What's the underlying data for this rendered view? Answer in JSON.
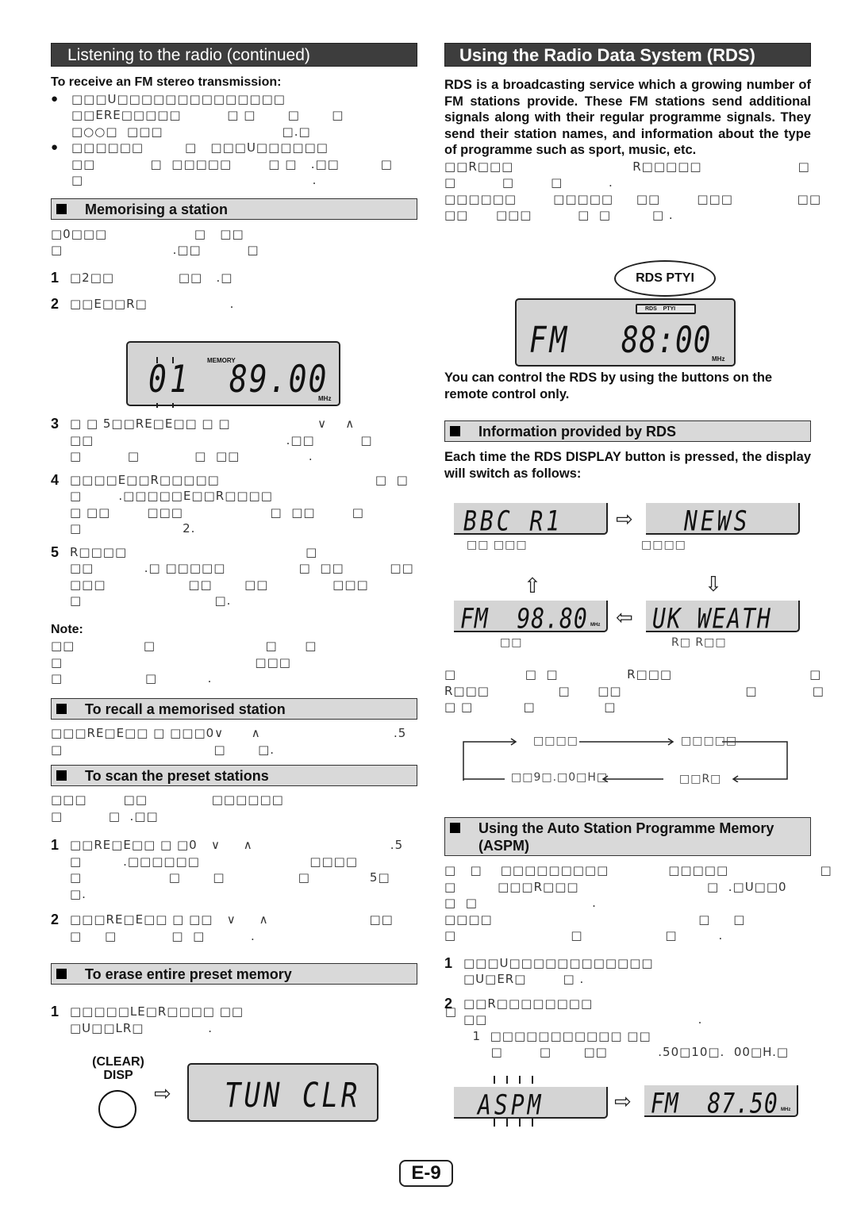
{
  "page_number": "E-9",
  "left": {
    "header": "Listening to the radio (continued)",
    "fm_stereo": {
      "title": "To receive an FM stereo transmission:",
      "bullets": [
        [
          "□□□U□□□□□□□□□□□□□□",
          "□□ERE□□□□□          □ □       □       □",
          "□○○□  □□□                          □.□"
        ],
        [
          "□□□□□□         □   □□□U□□□□□□",
          "□□            □  □□□□□        □ □   .□□         □",
          "□                                                  ."
        ]
      ]
    },
    "memorising": {
      "title": "Memorising a station",
      "intro": [
        "□0□□□                   □   □□",
        "□                        .□□          □"
      ],
      "steps": [
        {
          "num": "1",
          "lines": [
            "□2□□              □□   .□"
          ]
        },
        {
          "num": "2",
          "lines": [
            "□□E□□R□                  ."
          ]
        }
      ],
      "display": {
        "preset": "01",
        "indicator": "MEMORY",
        "frequency": "89.00",
        "unit": "MHz"
      },
      "steps_after": [
        {
          "num": "3",
          "lines": [
            "□ □ 5□□RE□E□□ □ □                   ∨    ∧",
            "□□                                          .□□          □",
            "□          □            □  □□               ."
          ]
        },
        {
          "num": "4",
          "lines": [
            "□□□□E□□R□□□□□                                  □  □",
            "□        .□□□□□E□□R□□□□",
            "□ □□        □□□                   □  □□        □",
            "□                      2."
          ]
        },
        {
          "num": "5",
          "lines": [
            "R□□□□                                       □",
            "□□           .□ □□□□□                □  □□          □□",
            "□□□                  □□       □□              □□□",
            "□                             □."
          ]
        }
      ],
      "note_label": "Note:",
      "note_lines": [
        "□□               □                        □      □",
        "□                                          □□□",
        "□                  □           ."
      ]
    },
    "recall": {
      "title": "To recall a memorised station",
      "lines": [
        "□□□RE□E□□ □ □□□0∨      ∧                             .5",
        "□                                 □       □."
      ]
    },
    "scan": {
      "title": "To scan the preset stations",
      "intro": [
        "□□□        □□              □□□□□□",
        "□          □  .□□"
      ],
      "steps": [
        {
          "num": "1",
          "lines": [
            "□□RE□E□□ □ □0   ∨     ∧                              .5",
            "□         .□□□□□□                        □□□□",
            "□                   □       □                □             5□",
            "□."
          ]
        },
        {
          "num": "2",
          "lines": [
            "□□□RE□E□□ □ □□   ∨     ∧                      □□",
            "□     □            □  □          ."
          ]
        }
      ]
    },
    "erase": {
      "title": "To erase entire preset memory",
      "steps": [
        {
          "num": "1",
          "lines": [
            "□□□□□LE□R□□□□ □□                                            □",
            "□U□□LR□              ."
          ]
        }
      ],
      "button_label_top": "(CLEAR)",
      "button_label_bottom": "DISP",
      "display": "TUN CLR"
    }
  },
  "right": {
    "header": "Using the Radio Data System (RDS)",
    "intro": "RDS is a broadcasting service which a growing number of FM stations provide. These FM stations send additional signals along with their regular programme signals. They send their station names, and information about the type of programme such as sport, music, etc.",
    "intro_garbled": [
      "□□R□□□                          R□□□□□                     □",
      "□          □        □          .",
      "□□□□□□        □□□□□     □□        □□□              □□",
      "□□      □□□          □  □         □ ."
    ],
    "rds_callout": "RDS PTYI",
    "rds_display": {
      "indicators": [
        "RDS",
        "PTYI"
      ],
      "mode": "FM",
      "frequency": "88:00",
      "unit": "MHz"
    },
    "remote_note": "You can control the RDS by using the buttons on the remote control only.",
    "info": {
      "title": "Information provided by RDS",
      "intro": "Each time the RDS DISPLAY button is pressed, the display will switch as follows:",
      "displays": [
        {
          "text": "BBC R1",
          "caption": "□□ □□□"
        },
        {
          "text": "NEWS",
          "caption": "□□□□"
        },
        {
          "text": "UK WEATH",
          "caption": "R□ R□□"
        },
        {
          "text": "FM  98.80",
          "unit": "MHz",
          "caption": "□□"
        }
      ],
      "after_lines": [
        "□               □  □               R□□□                              □",
        "R□□□               □      □□                           □            □",
        "□ □           □               □"
      ],
      "cycle": [
        "□□□□",
        "□□□□□",
        "□□R□",
        "□□9□.□0□H□"
      ]
    },
    "aspm": {
      "title": "Using the Auto Station Programme Memory (ASPM)",
      "intro": [
        "□   □    □□□□□□□□□             □□□□□                    □",
        "□         □□□R□□□                            □  .□U□□0",
        "□  □                         .",
        "□□□□                                             □     □",
        "□                         □                  □         ."
      ],
      "steps": [
        {
          "num": "1",
          "lines": [
            "□□□U□□□□□□□□□□□□",
            "□U□ER□        □ ."
          ]
        },
        {
          "num": "2",
          "lines": [
            "□□R□□□□□□□□",
            "□□                                              .",
            "  1  □□□□□□□□□□□ □□",
            "      □        □       □□           .50□10□.  00□H.□"
          ]
        }
      ],
      "display_left": "ASPM",
      "display_right": "FM  87.50",
      "unit": "MHz"
    }
  }
}
